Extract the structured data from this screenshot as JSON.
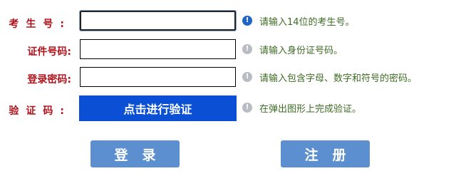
{
  "form": {
    "rows": [
      {
        "label": "考生号:",
        "value": "",
        "hint": "请输入14位的考生号。",
        "icon": "info-icon"
      },
      {
        "label": "证件号码:",
        "value": "",
        "hint": "请输入身份证号码。",
        "icon": "info-icon"
      },
      {
        "label": "登录密码:",
        "value": "",
        "hint": "请输入包含字母、数字和符号的密码。",
        "icon": "info-icon"
      },
      {
        "label": "验证码:",
        "hint": "在弹出图形上完成验证。",
        "icon": "info-icon"
      }
    ],
    "info_glyph": "!",
    "verify_button": "点击进行验证",
    "login_button": "登录",
    "register_button": "注册"
  },
  "colors": {
    "label": "#b0121b",
    "hint": "#3e6b24",
    "verify_button_bg": "#0a4fd4",
    "action_button_bg": "#5b8fd0",
    "active_icon": "#1f66c3",
    "inactive_icon": "#b9bcc2"
  }
}
